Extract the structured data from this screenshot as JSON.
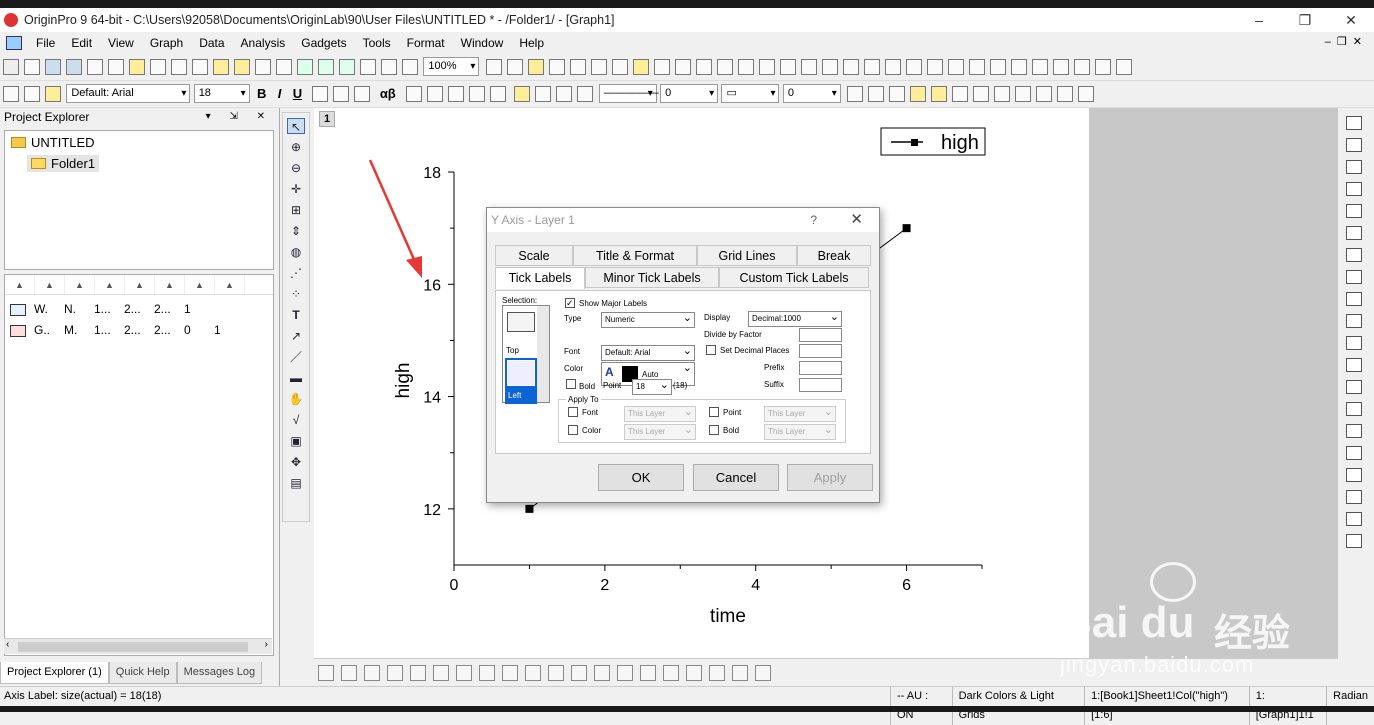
{
  "window": {
    "title": "OriginPro 9 64-bit - C:\\Users\\92058\\Documents\\OriginLab\\90\\User Files\\UNTITLED * - /Folder1/ - [Graph1]",
    "controls": [
      "–",
      "❐",
      "✕"
    ]
  },
  "menu": [
    "File",
    "Edit",
    "View",
    "Graph",
    "Data",
    "Analysis",
    "Gadgets",
    "Tools",
    "Format",
    "Window",
    "Help"
  ],
  "toolbar": {
    "zoom": "100%",
    "font": "Default: Arial",
    "font_size": "18",
    "bold": "B",
    "italic": "I",
    "underline": "U",
    "alpha_beta": "αβ",
    "num_a": "0",
    "num_b": "0"
  },
  "project_explorer": {
    "title": "Project Explorer",
    "root": "UNTITLED",
    "folder": "Folder1",
    "rows": [
      [
        "B",
        "W.",
        "N.",
        "1...",
        "2...",
        "2...",
        "1",
        ""
      ],
      [
        "G",
        "G..",
        "M.",
        "1...",
        "2...",
        "2...",
        "0",
        "1"
      ]
    ],
    "tabs": [
      "Project Explorer (1)",
      "Quick Help",
      "Messages Log"
    ]
  },
  "graph": {
    "layer_badge": "1",
    "legend": "high"
  },
  "chart_data": {
    "type": "line",
    "title": "",
    "xlabel": "time",
    "ylabel": "high",
    "x_ticks": [
      "0",
      "2",
      "4",
      "6"
    ],
    "y_ticks": [
      "12",
      "14",
      "16",
      "18"
    ],
    "xlim": [
      0,
      7
    ],
    "ylim": [
      11,
      18
    ],
    "grid": false,
    "legend_position": "top-right",
    "series": [
      {
        "name": "high",
        "color": "#000000",
        "x": [
          1,
          6
        ],
        "y": [
          12.0,
          17.0
        ]
      }
    ]
  },
  "dialog": {
    "title": "Y Axis - Layer 1",
    "help": "?",
    "close": "✕",
    "tabs_row1": [
      "Scale",
      "Title & Format",
      "Grid Lines",
      "Break"
    ],
    "tabs_row2": [
      "Tick Labels",
      "Minor Tick Labels",
      "Custom Tick Labels"
    ],
    "selection_label": "Selection:",
    "sel_top": "Top",
    "sel_left": "Left",
    "show_major": "Show Major Labels",
    "type_label": "Type",
    "type_value": "Numeric",
    "display_label": "Display",
    "display_value": "Decimal:1000",
    "divide_label": "Divide by Factor",
    "set_decimal": "Set Decimal Places",
    "font_label": "Font",
    "font_value": "Default: Arial",
    "color_label": "Color",
    "color_value": "Auto",
    "bold_label": "Bold",
    "point_label": "Point",
    "point_value": "18",
    "point_actual": "(18)",
    "prefix_label": "Prefix",
    "suffix_label": "Suffix",
    "apply_to": "Apply To",
    "apply_font": "Font",
    "apply_color": "Color",
    "apply_point": "Point",
    "apply_bold": "Bold",
    "this_layer": "This Layer",
    "ok": "OK",
    "cancel": "Cancel",
    "apply": "Apply"
  },
  "status": {
    "left": "Axis Label: size(actual) = 18(18)",
    "segments": [
      "-- AU : ON",
      "Dark Colors & Light Grids",
      "1:[Book1]Sheet1!Col(\"high\")[1:6]",
      "1:[Graph1]1!1",
      "Radian"
    ]
  },
  "watermark": {
    "brand": "Bai du",
    "cn": "经验",
    "url": "jingyan.baidu.com"
  }
}
